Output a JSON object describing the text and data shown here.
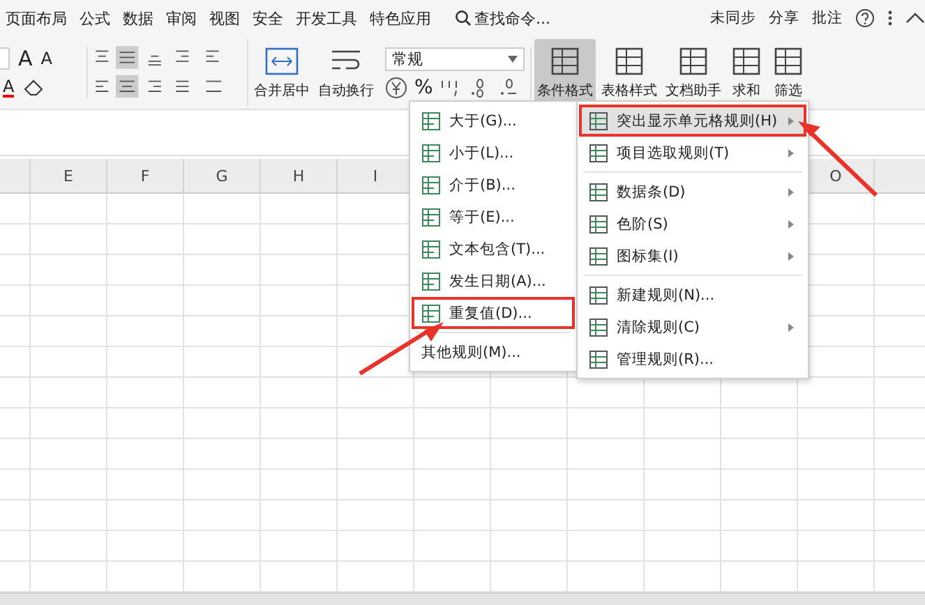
{
  "menu_tabs": [
    "页面布局",
    "公式",
    "数据",
    "审阅",
    "视图",
    "安全",
    "开发工具",
    "特色应用"
  ],
  "search": {
    "placeholder": "查找命令..."
  },
  "top_actions": [
    "未同步",
    "分享",
    "批注"
  ],
  "ribbon": {
    "font_letters": [
      "A",
      "A",
      "A"
    ],
    "merge_button": "合并居中",
    "wrap_button": "自动换行",
    "number_format": {
      "value": "常规"
    },
    "percent": "%",
    "big_buttons": [
      {
        "label": "条件格式",
        "selected": true
      },
      {
        "label": "表格样式",
        "selected": false
      },
      {
        "label": "文档助手",
        "selected": false
      },
      {
        "label": "求和",
        "selected": false
      },
      {
        "label": "筛选",
        "selected": false
      }
    ]
  },
  "column_headers": [
    "E",
    "F",
    "G",
    "H",
    "I",
    "O"
  ],
  "rules_menu": {
    "groups": [
      [
        {
          "label": "突出显示单元格规则(H)",
          "has_submenu": true,
          "selected": true,
          "annotated": true
        },
        {
          "label": "项目选取规则(T)",
          "has_submenu": true,
          "selected": false,
          "annotated": false
        }
      ],
      [
        {
          "label": "数据条(D)",
          "has_submenu": true,
          "selected": false,
          "annotated": false
        },
        {
          "label": "色阶(S)",
          "has_submenu": true,
          "selected": false,
          "annotated": false
        },
        {
          "label": "图标集(I)",
          "has_submenu": true,
          "selected": false,
          "annotated": false
        }
      ],
      [
        {
          "label": "新建规则(N)...",
          "has_submenu": false,
          "selected": false,
          "annotated": false
        },
        {
          "label": "清除规则(C)",
          "has_submenu": true,
          "selected": false,
          "annotated": false
        },
        {
          "label": "管理规则(R)...",
          "has_submenu": false,
          "selected": false,
          "annotated": false
        }
      ]
    ]
  },
  "highlight_submenu": {
    "groups": [
      [
        {
          "label": "大于(G)...",
          "annotated": false
        },
        {
          "label": "小于(L)...",
          "annotated": false
        },
        {
          "label": "介于(B)...",
          "annotated": false
        },
        {
          "label": "等于(E)...",
          "annotated": false
        },
        {
          "label": "文本包含(T)...",
          "annotated": false
        },
        {
          "label": "发生日期(A)...",
          "annotated": false
        },
        {
          "label": "重复值(D)...",
          "annotated": true
        }
      ],
      [
        {
          "label": "其他规则(M)...",
          "annotated": false
        }
      ]
    ]
  }
}
